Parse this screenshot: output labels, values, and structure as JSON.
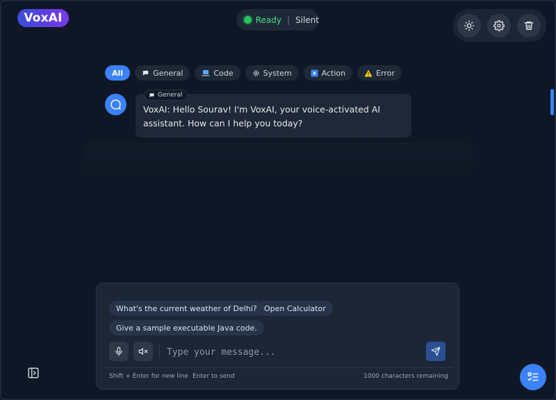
{
  "app": {
    "logo_text": "VoxAI"
  },
  "status": {
    "state": "Ready",
    "mode": "Silent",
    "state_color": "#22c55e"
  },
  "toolbar": {
    "buttons": [
      {
        "icon": "sun-icon",
        "name": "theme-toggle-button"
      },
      {
        "icon": "gear-icon",
        "name": "settings-button"
      },
      {
        "icon": "trash-icon",
        "name": "clear-chat-button"
      }
    ]
  },
  "filters": [
    {
      "label": "All",
      "icon": "",
      "active": true
    },
    {
      "label": "General",
      "icon": "speech-bubble-icon"
    },
    {
      "label": "Code",
      "icon": "laptop-icon"
    },
    {
      "label": "System",
      "icon": "gear-icon"
    },
    {
      "label": "Action",
      "icon": "play-icon"
    },
    {
      "label": "Error",
      "icon": "warning-icon"
    }
  ],
  "messages": [
    {
      "tag": "General",
      "text": "VoxAI: Hello Sourav! I'm VoxAI, your voice-activated AI assistant. How can I help you today?"
    }
  ],
  "suggestions": [
    "What's the current weather of Delhi?",
    "Open Calculator",
    "Give a sample executable Java code."
  ],
  "composer": {
    "placeholder": "Type your message...",
    "value": "",
    "hint_newline": "Shift + Enter for new line",
    "hint_send": "Enter to send",
    "chars_remaining": "1000 characters remaining"
  },
  "colors": {
    "accent": "#3b82f6",
    "background": "#0f1726"
  }
}
